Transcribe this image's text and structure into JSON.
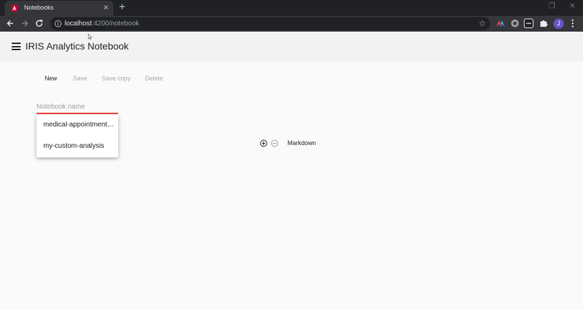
{
  "browser": {
    "tab": {
      "title": "Notebooks",
      "favicon": "angular-icon"
    },
    "url": {
      "host": "localhost",
      "path": ":4200/notebook"
    },
    "profile_initial": "J"
  },
  "app": {
    "title": "IRIS Analytics Notebook",
    "menu_icon": "hamburger-menu-icon"
  },
  "actions": {
    "new": "New",
    "save": "Save",
    "save_copy": "Save copy",
    "delete": "Delete"
  },
  "notebook_name": {
    "placeholder": "Notebook name",
    "value": "",
    "underline_color": "#f44336"
  },
  "dropdown": {
    "options": [
      "medical-appointments-analysis",
      "my-custom-analysis"
    ]
  },
  "cell": {
    "type_label": "Markdown",
    "add_icon": "add-circle-icon",
    "remove_icon": "remove-circle-icon"
  }
}
